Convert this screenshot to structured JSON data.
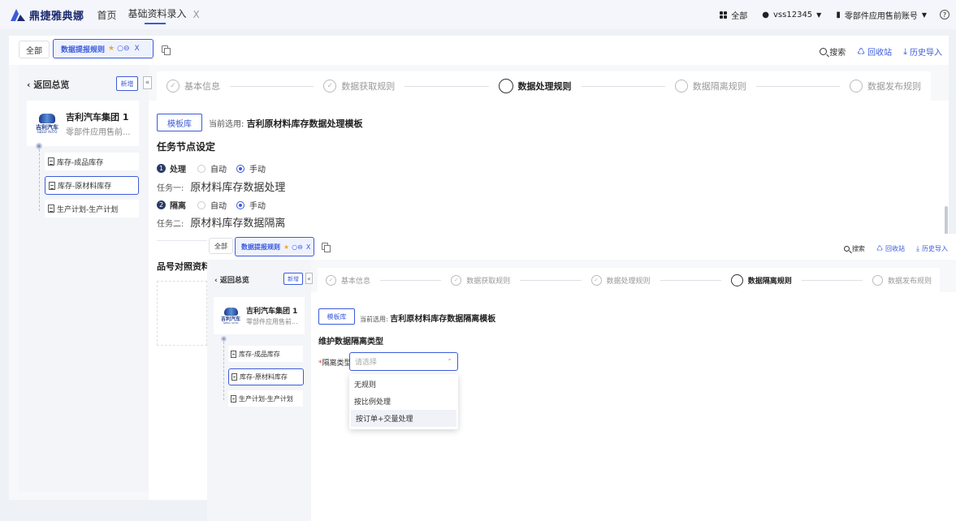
{
  "app": {
    "logo_text": "鼎捷雅典娜",
    "nav_home": "首页",
    "nav_current": "基础资料录入",
    "nav_close": "X",
    "all_label": "全部",
    "user": "vss12345",
    "account": "零部件应用售前账号",
    "help": "?",
    "caret": "▼"
  },
  "panel": {
    "tab_all": "全部",
    "tab_active": "数据提报规则",
    "tab_star": "★",
    "tab_ctrls": "○⊖",
    "tab_close": "X",
    "search": "搜索",
    "recycle": "回收站",
    "history": "历史导入",
    "back": "‹ 返回总览",
    "new": "新增",
    "collapse": "«",
    "company_name": "吉利汽车集团 1",
    "company_sub": "零部件应用售前...",
    "logo_cn": "吉利汽车",
    "logo_en": "GEELY AUTO",
    "tree": [
      "库存-成品库存",
      "库存-原材料库存",
      "生产计划-生产计划"
    ],
    "steps": [
      "基本信息",
      "数据获取规则",
      "数据处理规则",
      "数据隔离规则",
      "数据发布规则"
    ],
    "tpl_btn": "模板库",
    "cur_prefix": "当前选用:",
    "check": "✓"
  },
  "back_panel": {
    "cur_template": "吉利原材料库存数据处理模板",
    "section": "任务节点设定",
    "node1_num": "1",
    "node1": "处理",
    "node2_num": "2",
    "node2": "隔离",
    "auto": "自动",
    "manual": "手动",
    "task1_label": "任务一:",
    "task1": "原材料库存数据处理",
    "task2_label": "任务二:",
    "task2": "原材料库存数据隔离",
    "section2": "品号对照资料"
  },
  "front_panel": {
    "cur_template": "吉利原材料库存数据隔离模板",
    "section": "维护数据隔离类型",
    "field_label": "隔离类型:",
    "field_req": "*",
    "placeholder": "请选择",
    "arrow": "⌃",
    "options": [
      "无规则",
      "按比例处理",
      "按订单+交量处理"
    ]
  }
}
